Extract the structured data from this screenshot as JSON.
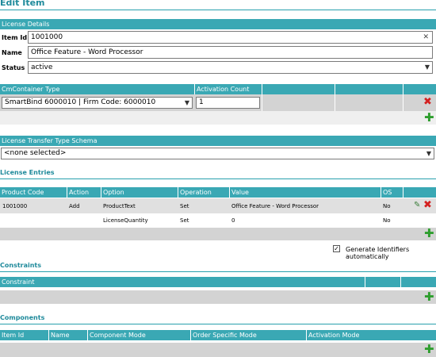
{
  "page": {
    "title": "Edit Item"
  },
  "license_details": {
    "header": "License Details",
    "item_id_label": "Item Id",
    "item_id_value": "1001000",
    "name_label": "Name",
    "name_value": "Office Feature - Word Processor",
    "status_label": "Status",
    "status_value": "active"
  },
  "container": {
    "col_type": "CmContainer Type",
    "col_count": "Activation Count",
    "type_value": "SmartBind 6000010 | Firm Code: 6000010",
    "count_value": "1"
  },
  "transfer": {
    "header": "License Transfer Type Schema",
    "value": "<none selected>"
  },
  "license_entries": {
    "title": "License Entries",
    "columns": [
      "Product Code",
      "Action",
      "Option",
      "Operation",
      "Value",
      "OS"
    ],
    "rows": [
      [
        "1001000",
        "Add",
        "ProductText",
        "Set",
        "Office Feature - Word Processor",
        "No"
      ],
      [
        "",
        "",
        "LicenseQuantity",
        "Set",
        "0",
        "No"
      ]
    ]
  },
  "generate": {
    "label": "Generate Identifiers automatically",
    "checked": true
  },
  "constraints": {
    "title": "Constraints",
    "columns": [
      "Constraint"
    ]
  },
  "components": {
    "title": "Components",
    "columns": [
      "Item Id",
      "Name",
      "Component Mode",
      "Order Specific Mode",
      "Activation Mode"
    ]
  },
  "icons": {
    "delete": "delete-icon",
    "add": "add-icon",
    "edit": "edit-icon"
  },
  "colors": {
    "accent": "#3aa8b4",
    "title": "#1f8a9b",
    "delete": "#d42020",
    "add": "#2e9e2e"
  }
}
